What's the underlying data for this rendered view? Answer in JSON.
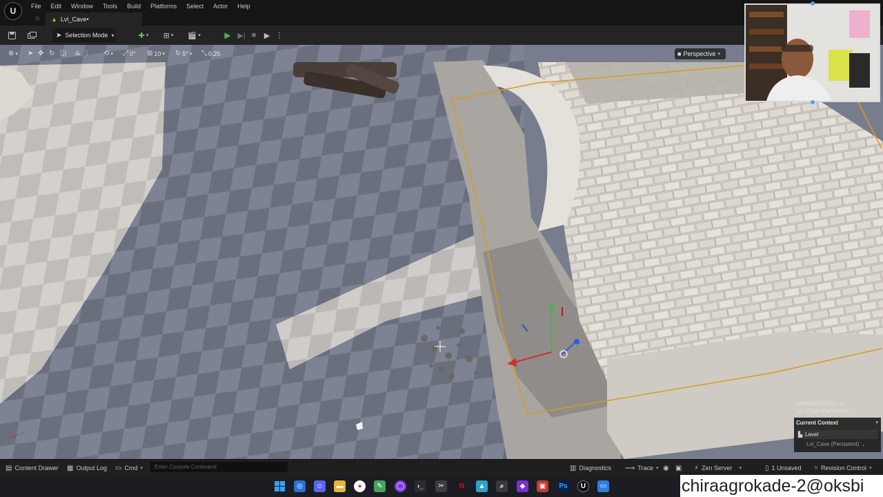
{
  "menu": {
    "items": [
      "File",
      "Edit",
      "Window",
      "Tools",
      "Build",
      "Platforms",
      "Select",
      "Actor",
      "Help"
    ]
  },
  "tab": {
    "level_name": "Lvl_Cave•"
  },
  "toolbar": {
    "mode_label": "Selection Mode"
  },
  "viewport": {
    "rotate_snap": "0°",
    "grid_snap": "10",
    "angle_snap": "5°",
    "scale_snap": "0.25",
    "view_mode": "Perspective",
    "selected_actor_line1": "Selected Actor(s) in",
    "selected_actor_line2": "Lvl_Cave (Persistent)",
    "current_context_label": "Current Context",
    "level_label": "Level",
    "level_value": "Lvl_Cave (Persistent)"
  },
  "statusbar": {
    "content_drawer": "Content Drawer",
    "output_log": "Output Log",
    "cmd": "Cmd",
    "console_placeholder": "Enter Console Command",
    "diagnostics": "Diagnostics",
    "trace": "Trace",
    "zen_server": "Zen Server",
    "unsaved": "1 Unsaved",
    "revision_control": "Revision Control"
  },
  "watermark": {
    "text": "chiraagrokade-2@oksbi"
  },
  "colors": {
    "selection_outline": "#d99a1f",
    "play_green": "#48b548",
    "taskbar_bg": "#1b1d22"
  }
}
